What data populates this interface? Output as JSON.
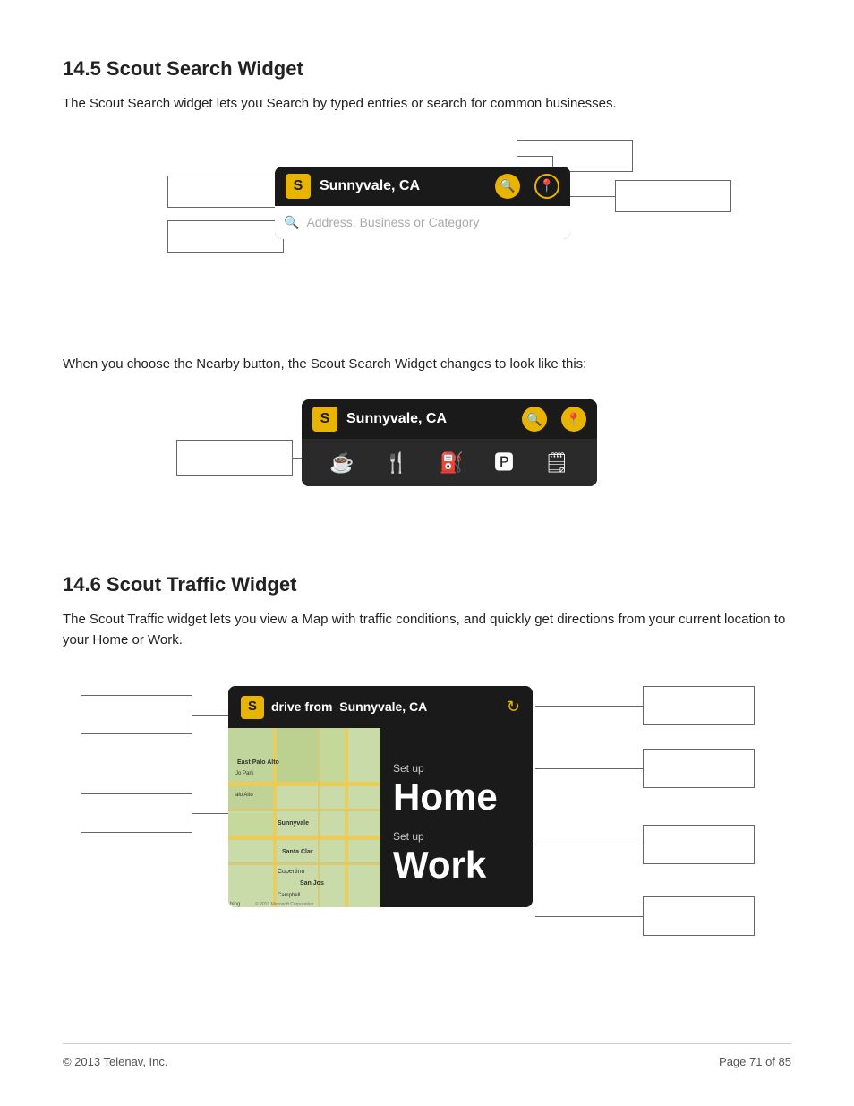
{
  "page": {
    "section1": {
      "title": "14.5 Scout Search Widget",
      "description": "The Scout Search widget lets you Search by typed entries or search for common businesses.",
      "widget": {
        "location": "Sunnyvale, CA",
        "search_placeholder": "Address, Business or Category"
      },
      "nearby_intro": "When you choose the Nearby button, the Scout Search Widget changes to look like this:",
      "nearby_location": "Sunnyvale, CA"
    },
    "section2": {
      "title": "14.6 Scout Traffic Widget",
      "description": "The Scout Traffic widget lets you view a Map with traffic conditions, and quickly get directions from your current location to your Home or Work.",
      "widget": {
        "drive_from": "drive from",
        "location": "Sunnyvale, CA",
        "setup_home_label": "Set up",
        "home_text": "Home",
        "setup_work_label": "Set up",
        "work_text": "Work"
      }
    },
    "footer": {
      "copyright": "© 2013 Telenav, Inc.",
      "page_info": "Page 71 of 85"
    }
  }
}
